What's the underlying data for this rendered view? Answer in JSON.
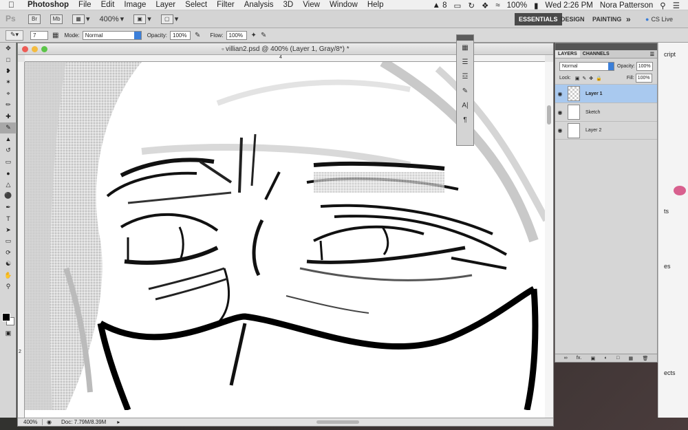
{
  "menubar": {
    "app": "Photoshop",
    "items": [
      "File",
      "Edit",
      "Image",
      "Layer",
      "Select",
      "Filter",
      "Analysis",
      "3D",
      "View",
      "Window",
      "Help"
    ],
    "status": {
      "adobe_count": "8",
      "battery": "100%",
      "clock": "Wed 2:26 PM",
      "user": "Nora Patterson"
    }
  },
  "appbar": {
    "logo": "Ps",
    "zoom": "400%",
    "workspaces": [
      "ESSENTIALS",
      "DESIGN",
      "PAINTING"
    ],
    "more": "»",
    "cslive": "CS Live"
  },
  "options": {
    "brush_size": "7",
    "mode_label": "Mode:",
    "mode_value": "Normal",
    "opacity_label": "Opacity:",
    "opacity_value": "100%",
    "flow_label": "Flow:",
    "flow_value": "100%"
  },
  "document": {
    "title": "villian2.psd @ 400% (Layer 1, Gray/8*) *",
    "ruler_h_mark": "4",
    "ruler_v_mark": "2",
    "zoom": "400%",
    "doc_size": "Doc: 7.79M/8.39M"
  },
  "layers_panel": {
    "tabs": [
      "LAYERS",
      "CHANNELS"
    ],
    "blend_mode": "Normal",
    "opacity_label": "Opacity:",
    "opacity": "100%",
    "lock_label": "Lock:",
    "fill_label": "Fill:",
    "fill": "100%",
    "layers": [
      {
        "name": "Layer 1",
        "selected": true
      },
      {
        "name": "Sketch",
        "selected": false
      },
      {
        "name": "Layer 2",
        "selected": false
      }
    ],
    "footer_fx": "fx."
  },
  "behind_window": {
    "text1": "cript",
    "text2": "ts",
    "text3": "es",
    "text4": "ects"
  },
  "colors": {
    "accent": "#3b7fd9",
    "selected_layer": "#a9c9ef",
    "workspace_active": "#4a4a4a"
  }
}
